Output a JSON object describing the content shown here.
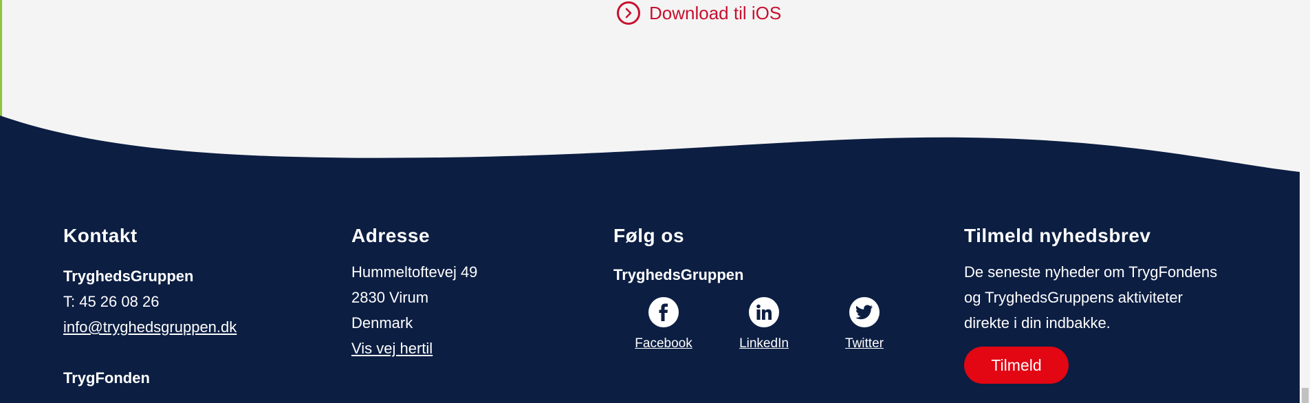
{
  "top": {
    "ios_link": "Download til iOS"
  },
  "kontakt": {
    "heading": "Kontakt",
    "org1": "TryghedsGruppen",
    "phone": "T: 45 26 08 26",
    "email": "info@tryghedsgruppen.dk",
    "org2": "TrygFonden"
  },
  "adresse": {
    "heading": "Adresse",
    "street": "Hummeltoftevej 49",
    "city": "2830 Virum",
    "country": "Denmark",
    "directions": "Vis vej hertil"
  },
  "follow": {
    "heading": "Følg os",
    "org": "TryghedsGruppen",
    "socials": [
      {
        "label": "Facebook",
        "icon": "facebook-icon"
      },
      {
        "label": "LinkedIn",
        "icon": "linkedin-icon"
      },
      {
        "label": "Twitter",
        "icon": "twitter-icon"
      }
    ]
  },
  "newsletter": {
    "heading": "Tilmeld nyhedsbrev",
    "line1": "De seneste nyheder om TrygFondens",
    "line2": "og TryghedsGruppens aktiviteter",
    "line3": "direkte i din indbakke.",
    "button": "Tilmeld"
  },
  "colors": {
    "footer_bg": "#0c1e42",
    "accent_red": "#c8102e",
    "button_red": "#e30613",
    "page_bg": "#f4f4f4"
  }
}
